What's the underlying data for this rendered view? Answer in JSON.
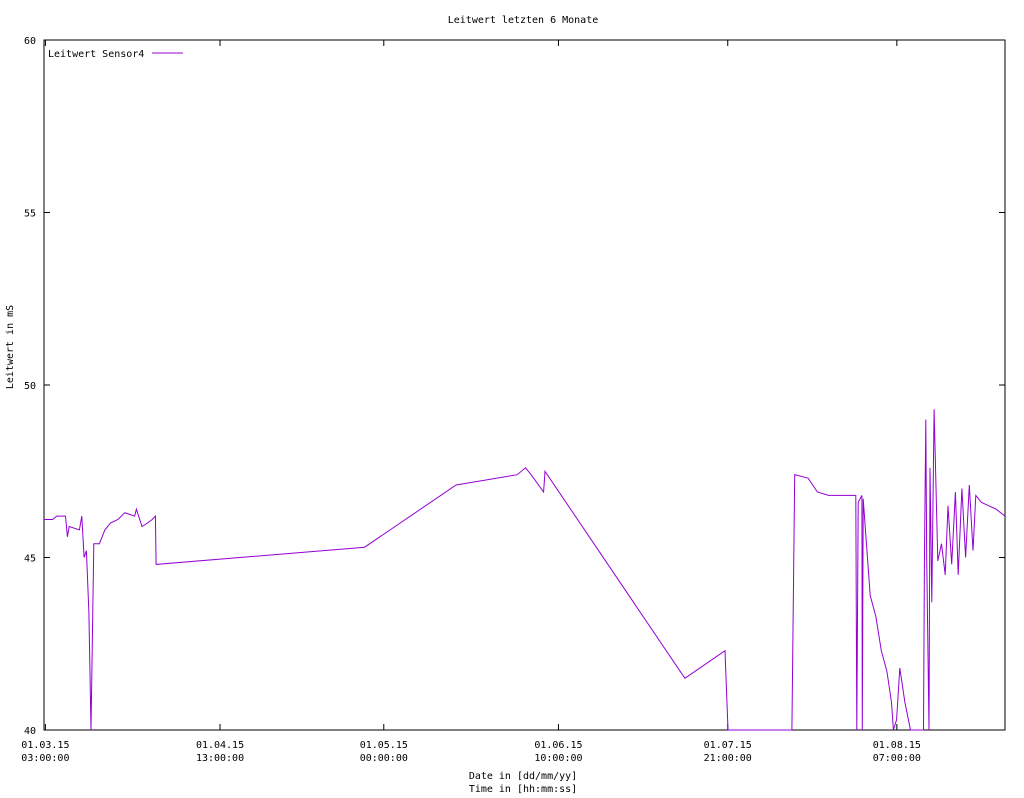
{
  "chart_data": {
    "type": "line",
    "title": "Leitwert letzten 6 Monate",
    "xlabel_line1": "Date in [dd/mm/yy]",
    "xlabel_line2": "Time in [hh:mm:ss]",
    "ylabel": "Leitwert in mS",
    "ylim": [
      40,
      60
    ],
    "yticks": [
      40,
      45,
      50,
      55,
      60
    ],
    "xlim": [
      "2015-02-28 21:00",
      "2015-08-20 18:00"
    ],
    "xticks": [
      {
        "date": "01.03.15",
        "time": "03:00:00",
        "at": "2015-03-01 03:00"
      },
      {
        "date": "01.04.15",
        "time": "13:00:00",
        "at": "2015-04-01 13:00"
      },
      {
        "date": "01.05.15",
        "time": "00:00:00",
        "at": "2015-05-01 00:00"
      },
      {
        "date": "01.06.15",
        "time": "10:00:00",
        "at": "2015-06-01 10:00"
      },
      {
        "date": "01.07.15",
        "time": "21:00:00",
        "at": "2015-07-01 21:00"
      },
      {
        "date": "01.08.15",
        "time": "07:00:00",
        "at": "2015-08-01 07:00"
      }
    ],
    "legend_position": "top-left",
    "grid": false,
    "series": [
      {
        "name": "Leitwert Sensor4",
        "color": "#9400d3",
        "points": [
          [
            "2015-02-28 21:00",
            46.1
          ],
          [
            "2015-03-01 12:00",
            46.1
          ],
          [
            "2015-03-02 10:00",
            46.1
          ],
          [
            "2015-03-03 04:00",
            46.2
          ],
          [
            "2015-03-04 18:00",
            46.2
          ],
          [
            "2015-03-05 02:00",
            45.6
          ],
          [
            "2015-03-05 10:00",
            45.9
          ],
          [
            "2015-03-07 06:00",
            45.8
          ],
          [
            "2015-03-07 16:00",
            46.2
          ],
          [
            "2015-03-08 02:00",
            45.0
          ],
          [
            "2015-03-08 12:00",
            45.2
          ],
          [
            "2015-03-08 23:00",
            43.4
          ],
          [
            "2015-03-09 08:00",
            40.0
          ],
          [
            "2015-03-09 20:00",
            45.4
          ],
          [
            "2015-03-10 20:00",
            45.4
          ],
          [
            "2015-03-11 20:00",
            45.8
          ],
          [
            "2015-03-12 20:00",
            46.0
          ],
          [
            "2015-03-14 04:00",
            46.1
          ],
          [
            "2015-03-15 10:00",
            46.3
          ],
          [
            "2015-03-17 04:00",
            46.2
          ],
          [
            "2015-03-17 12:00",
            46.4
          ],
          [
            "2015-03-18 12:00",
            45.9
          ],
          [
            "2015-03-19 12:00",
            46.0
          ],
          [
            "2015-03-20 08:00",
            46.1
          ],
          [
            "2015-03-20 22:00",
            46.2
          ],
          [
            "2015-03-21 01:00",
            44.8
          ],
          [
            "2015-04-27 13:00",
            45.3
          ],
          [
            "2015-05-14 00:00",
            47.1
          ],
          [
            "2015-05-25 00:00",
            47.4
          ],
          [
            "2015-05-26 12:00",
            47.6
          ],
          [
            "2015-05-27 12:00",
            47.4
          ],
          [
            "2015-05-29 18:00",
            46.9
          ],
          [
            "2015-05-30 00:00",
            47.5
          ],
          [
            "2015-06-24 04:00",
            41.5
          ],
          [
            "2015-07-01 09:00",
            42.3
          ],
          [
            "2015-07-01 22:00",
            40.0
          ],
          [
            "2015-07-13 10:00",
            40.0
          ],
          [
            "2015-07-13 22:00",
            47.4
          ],
          [
            "2015-07-16 08:00",
            47.3
          ],
          [
            "2015-07-18 00:00",
            46.9
          ],
          [
            "2015-07-20 00:00",
            46.8
          ],
          [
            "2015-07-22 00:00",
            46.8
          ],
          [
            "2015-07-24 22:00",
            46.8
          ],
          [
            "2015-07-25 02:00",
            40.0
          ],
          [
            "2015-07-25 08:00",
            46.6
          ],
          [
            "2015-07-26 00:00",
            46.8
          ],
          [
            "2015-07-26 02:00",
            40.0
          ],
          [
            "2015-07-26 06:00",
            46.7
          ],
          [
            "2015-07-27 12:00",
            43.9
          ],
          [
            "2015-07-28 12:00",
            43.3
          ],
          [
            "2015-07-29 12:00",
            42.3
          ],
          [
            "2015-07-30 12:00",
            41.7
          ],
          [
            "2015-07-31 08:00",
            40.8
          ],
          [
            "2015-07-31 16:00",
            40.0
          ],
          [
            "2015-08-01 06:00",
            40.3
          ],
          [
            "2015-08-01 20:00",
            41.8
          ],
          [
            "2015-08-02 18:00",
            40.8
          ],
          [
            "2015-08-03 12:00",
            40.2
          ],
          [
            "2015-08-03 18:00",
            40.0
          ],
          [
            "2015-08-06 02:00",
            40.0
          ],
          [
            "2015-08-06 06:00",
            44.8
          ],
          [
            "2015-08-06 12:00",
            49.0
          ],
          [
            "2015-08-06 16:00",
            45.0
          ],
          [
            "2015-08-07 02:00",
            40.0
          ],
          [
            "2015-08-07 06:00",
            47.6
          ],
          [
            "2015-08-07 14:00",
            43.7
          ],
          [
            "2015-08-08 00:00",
            49.3
          ],
          [
            "2015-08-08 16:00",
            44.9
          ],
          [
            "2015-08-09 08:00",
            45.4
          ],
          [
            "2015-08-10 00:00",
            44.5
          ],
          [
            "2015-08-10 12:00",
            46.5
          ],
          [
            "2015-08-11 04:00",
            44.8
          ],
          [
            "2015-08-11 20:00",
            46.9
          ],
          [
            "2015-08-12 08:00",
            44.5
          ],
          [
            "2015-08-13 00:00",
            47.0
          ],
          [
            "2015-08-13 16:00",
            45.0
          ],
          [
            "2015-08-14 08:00",
            47.1
          ],
          [
            "2015-08-15 00:00",
            45.2
          ],
          [
            "2015-08-15 12:00",
            46.8
          ],
          [
            "2015-08-16 12:00",
            46.6
          ],
          [
            "2015-08-17 20:00",
            46.5
          ],
          [
            "2015-08-19 04:00",
            46.4
          ],
          [
            "2015-08-20 18:00",
            46.2
          ]
        ]
      }
    ]
  }
}
